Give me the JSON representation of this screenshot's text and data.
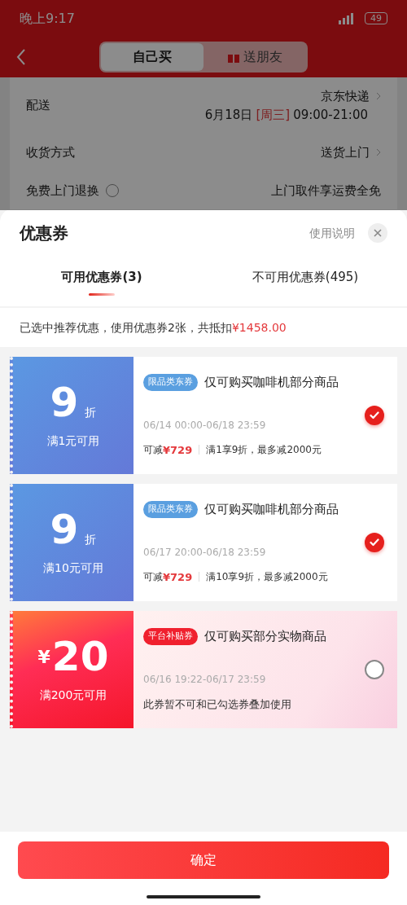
{
  "status_bar": {
    "time": "晚上9:17",
    "battery": "49"
  },
  "header": {
    "tabs": [
      {
        "label": "自己买",
        "selected": true
      },
      {
        "label": "送朋友",
        "selected": false
      }
    ]
  },
  "background_rows": [
    {
      "label": "配送",
      "value": "京东快递",
      "date": "6月18日",
      "weekday": "[周三]",
      "hours": "09:00-21:00",
      "info": false,
      "chevron": true
    },
    {
      "label": "收货方式",
      "value": "送货上门",
      "info": false,
      "chevron": true
    },
    {
      "label": "免费上门退换",
      "value": "上门取件享运费全免",
      "info": true,
      "chevron": false
    }
  ],
  "sheet": {
    "title": "优惠券",
    "help_link": "使用说明",
    "tabs": [
      {
        "label": "可用优惠券(3)",
        "selected": true
      },
      {
        "label": "不可用优惠券(495)",
        "selected": false
      }
    ],
    "summary": "已选中推荐优惠，使用优惠券2张，共抵扣",
    "summary_amount": "¥1458.00",
    "coupons": [
      {
        "kind": "discount",
        "amount": "9",
        "unit": "折",
        "threshold": "满1元可用",
        "tag": "限品类东券",
        "color": "#5a9fe0",
        "title": "仅可购买咖啡机部分商品",
        "validity": "06/14 00:00-06/18 23:59",
        "saving_label": "可减",
        "saving_amount": "¥729",
        "rule": "满1享9折，最多减2000元",
        "checked": true
      },
      {
        "kind": "discount",
        "amount": "9",
        "unit": "折",
        "threshold": "满10元可用",
        "tag": "限品类东券",
        "color": "#5a9fe0",
        "title": "仅可购买咖啡机部分商品",
        "validity": "06/17 20:00-06/18 23:59",
        "saving_label": "可减",
        "saving_amount": "¥729",
        "rule": "满10享9折，最多减2000元",
        "checked": true
      },
      {
        "kind": "cash",
        "amount": "20",
        "unit": "¥",
        "threshold": "满200元可用",
        "tag": "平台补贴券",
        "color": "#f0202e",
        "title": "仅可购买部分实物商品",
        "validity": "06/16 19:22-06/17 23:59",
        "note": "此券暂不可和已勾选券叠加使用",
        "checked": false
      }
    ],
    "confirm_button": "确定"
  }
}
